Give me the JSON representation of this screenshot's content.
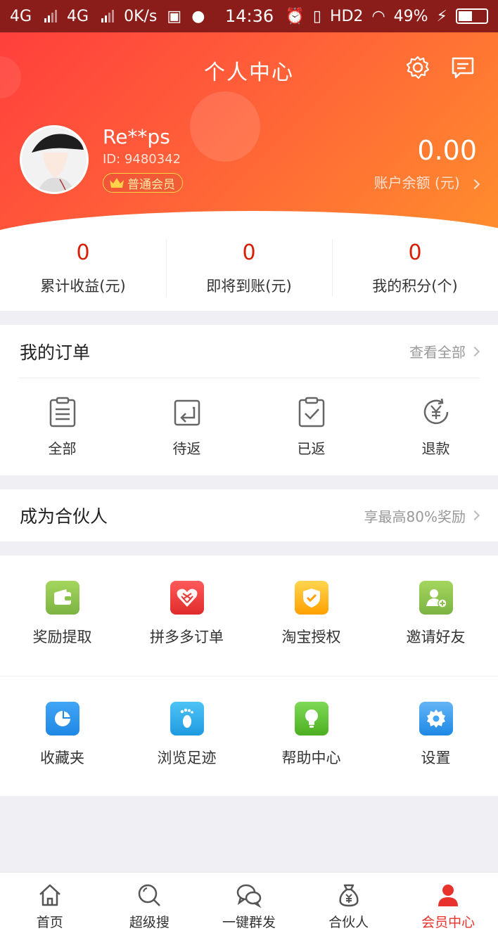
{
  "statusbar": {
    "net1": "4G",
    "net2": "4G",
    "speed": "0K/s",
    "time": "14:36",
    "hd": "HD2",
    "battery": "49%"
  },
  "header": {
    "title": "个人中心",
    "icons": [
      "gear-icon",
      "message-icon"
    ]
  },
  "profile": {
    "username": "Re**ps",
    "id": "ID: 9480342",
    "level": "普通会员",
    "balance": "0.00",
    "balance_label": "账户余额 (元)"
  },
  "stats": [
    {
      "value": "0",
      "label": "累计收益(元)"
    },
    {
      "value": "0",
      "label": "即将到账(元)"
    },
    {
      "value": "0",
      "label": "我的积分(个)"
    }
  ],
  "orders": {
    "title": "我的订单",
    "more": "查看全部",
    "items": [
      {
        "label": "全部",
        "icon": "clipboard-list-icon"
      },
      {
        "label": "待返",
        "icon": "return-pending-icon"
      },
      {
        "label": "已返",
        "icon": "clipboard-check-icon"
      },
      {
        "label": "退款",
        "icon": "yen-refund-icon"
      }
    ]
  },
  "partner": {
    "title": "成为合伙人",
    "more": "享最高80%奖励"
  },
  "services": [
    {
      "label": "奖励提取",
      "icon": "wallet-icon",
      "color": "#8bc34a"
    },
    {
      "label": "拼多多订单",
      "icon": "pinduoduo-icon",
      "color": "#e53935"
    },
    {
      "label": "淘宝授权",
      "icon": "shield-check-icon",
      "color": "#ffb300"
    },
    {
      "label": "邀请好友",
      "icon": "add-user-icon",
      "color": "#8bc34a"
    },
    {
      "label": "收藏夹",
      "icon": "pie-chart-icon",
      "color": "#2196f3"
    },
    {
      "label": "浏览足迹",
      "icon": "footprint-icon",
      "color": "#29a8f0"
    },
    {
      "label": "帮助中心",
      "icon": "lightbulb-icon",
      "color": "#66bb2a"
    },
    {
      "label": "设置",
      "icon": "settings-gear-icon",
      "color": "#42a5f5"
    }
  ],
  "tabs": [
    {
      "label": "首页",
      "icon": "home-icon"
    },
    {
      "label": "超级搜",
      "icon": "search-icon"
    },
    {
      "label": "一键群发",
      "icon": "chat-bubbles-icon"
    },
    {
      "label": "合伙人",
      "icon": "money-bag-icon"
    },
    {
      "label": "会员中心",
      "icon": "user-icon",
      "active": true
    }
  ],
  "colors": {
    "accent": "#e8322c",
    "stat_value": "#d81e06",
    "header_start": "#ff3c3c",
    "header_end": "#ff8d2d"
  }
}
